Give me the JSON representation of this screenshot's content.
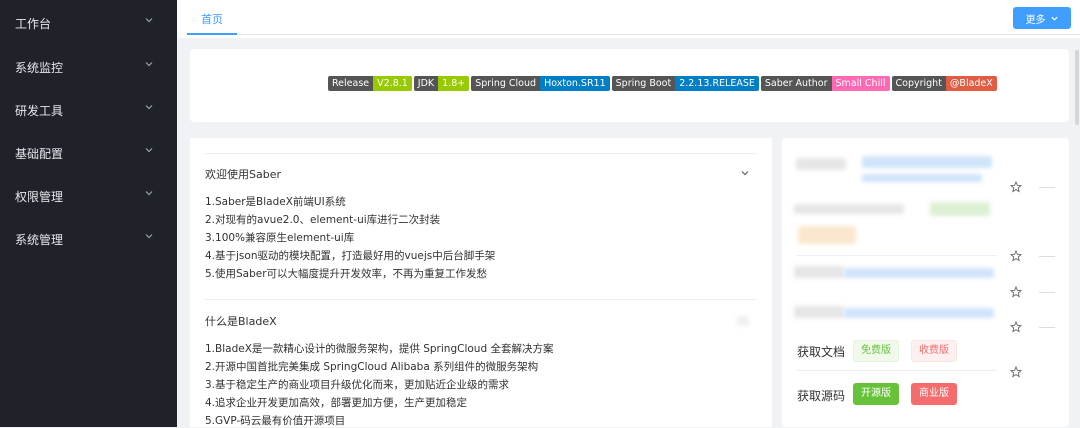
{
  "sidebar": {
    "items": [
      {
        "label": "工作台"
      },
      {
        "label": "系统监控"
      },
      {
        "label": "研发工具"
      },
      {
        "label": "基础配置"
      },
      {
        "label": "权限管理"
      },
      {
        "label": "系统管理"
      }
    ]
  },
  "header": {
    "tab_home": "首页",
    "more_label": "更多"
  },
  "badges": [
    {
      "key": "Release",
      "value": "V2.8.1",
      "color": "#97ca00"
    },
    {
      "key": "JDK",
      "value": "1.8+",
      "color": "#97ca00"
    },
    {
      "key": "Spring Cloud",
      "value": "Hoxton.SR11",
      "color": "#007ec6"
    },
    {
      "key": "Spring Boot",
      "value": "2.2.13.RELEASE",
      "color": "#007ec6"
    },
    {
      "key": "Saber Author",
      "value": "Small Chill",
      "color": "#ff69b4"
    },
    {
      "key": "Copyright",
      "value": "@BladeX",
      "color": "#e05d44"
    }
  ],
  "saber": {
    "title": "欢迎使用Saber",
    "items": [
      "1.Saber是BladeX前端UI系统",
      "2.对现有的avue2.0、element-ui库进行二次封装",
      "3.100%兼容原生element-ui库",
      "4.基于json驱动的模块配置，打造最好用的vuejs中后台脚手架",
      "5.使用Saber可以大幅度提升开发效率，不再为重复工作发愁"
    ]
  },
  "bladex": {
    "title": "什么是BladeX",
    "items": [
      "1.BladeX是一款精心设计的微服务架构，提供 SpringCloud 全套解决方案",
      "2.开源中国首批完美集成 SpringCloud Alibaba 系列组件的微服务架构",
      "3.基于稳定生产的商业项目升级优化而来，更加贴近企业级的需求",
      "4.追求企业开发更加高效，部署更加方便，生产更加稳定",
      "5.GVP-码云最有价值开源项目"
    ]
  },
  "docs": {
    "label": "获取文档",
    "free": "免费版",
    "paid": "收费版"
  },
  "source": {
    "label": "获取源码",
    "open": "开源版",
    "commercial": "商业版"
  }
}
